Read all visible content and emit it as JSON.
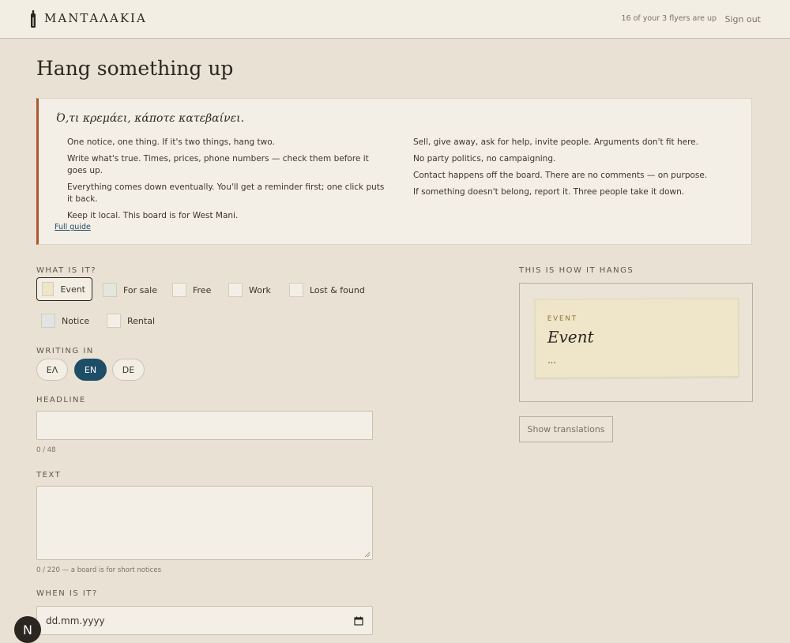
{
  "header": {
    "brand": "ΜΑΝΤΑΛΑΚΙΑ",
    "flyer_count": "16 of your 3 flyers are up",
    "signout": "Sign out"
  },
  "page": {
    "title": "Hang something up"
  },
  "guide": {
    "quote": "Ό,τι κρεμάει, κάποτε κατεβαίνει.",
    "left_rules": [
      "One notice, one thing. If it's two things, hang two.",
      "Write what's true. Times, prices, phone numbers — check them before it goes up.",
      "Everything comes down eventually. You'll get a reminder first; one click puts it back.",
      "Keep it local. This board is for West Mani."
    ],
    "right_rules": [
      "Sell, give away, ask for help, invite people. Arguments don't fit here.",
      "No party politics, no campaigning.",
      "Contact happens off the board. There are no comments — on purpose.",
      "If something doesn't belong, report it. Three people take it down."
    ],
    "link": "Full guide"
  },
  "form": {
    "category_label": "WHAT IS IT?",
    "categories": [
      {
        "label": "Event",
        "color": "#efe5c9",
        "selected": true
      },
      {
        "label": "For sale",
        "color": "#e3e6dc"
      },
      {
        "label": "Free",
        "color": "#f4efe6"
      },
      {
        "label": "Work",
        "color": "#f4efe6"
      },
      {
        "label": "Lost & found",
        "color": "#f4efe6"
      },
      {
        "label": "Notice",
        "color": "#dfe4e4"
      },
      {
        "label": "Rental",
        "color": "#f4efe6"
      }
    ],
    "language_label": "WRITING IN",
    "languages": [
      "ΕΛ",
      "EN",
      "DE"
    ],
    "selected_language": "EN",
    "headline_label": "HEADLINE",
    "headline_value": "",
    "headline_counter": "0 / 48",
    "text_label": "TEXT",
    "text_value": "",
    "text_counter": "0 / 220 — a board is for short notices",
    "when_label": "WHEN IS IT?",
    "date_placeholder": "dd.mm.yyyy"
  },
  "preview": {
    "label": "THIS IS HOW IT HANGS",
    "category": "EVENT",
    "title": "Event",
    "body": "...",
    "translate_button": "Show translations"
  },
  "user": {
    "initial": "N"
  },
  "colors": {
    "accent": "#1e4d68",
    "rule_bar": "#b3552f",
    "background": "#e9e1d3"
  }
}
